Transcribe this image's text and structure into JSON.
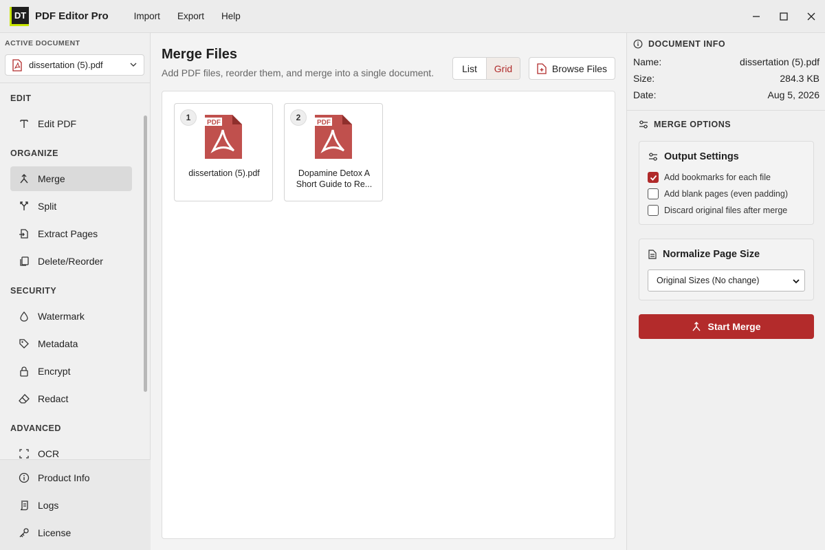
{
  "app": {
    "logo_text": "DT",
    "title": "PDF Editor Pro"
  },
  "menu": {
    "items": [
      "Import",
      "Export",
      "Help"
    ]
  },
  "sidebar": {
    "active_doc_label": "ACTIVE DOCUMENT",
    "active_doc_value": "dissertation (5).pdf",
    "sections": {
      "edit": "EDIT",
      "organize": "ORGANIZE",
      "security": "SECURITY",
      "advanced": "ADVANCED"
    },
    "items": {
      "edit_pdf": "Edit PDF",
      "merge": "Merge",
      "split": "Split",
      "extract_pages": "Extract Pages",
      "delete_reorder": "Delete/Reorder",
      "watermark": "Watermark",
      "metadata": "Metadata",
      "encrypt": "Encrypt",
      "redact": "Redact",
      "ocr": "OCR"
    },
    "bottom": {
      "product_info": "Product Info",
      "logs": "Logs",
      "license": "License"
    }
  },
  "main": {
    "title": "Merge Files",
    "subtitle": "Add PDF files, reorder them, and merge into a single document.",
    "view_list": "List",
    "view_grid": "Grid",
    "browse_label": "Browse Files",
    "thumb_label": "PDF",
    "files": [
      {
        "index": "1",
        "name": "dissertation (5).pdf"
      },
      {
        "index": "2",
        "name": "Dopamine Detox A Short Guide to Re..."
      }
    ]
  },
  "doc_info": {
    "heading": "DOCUMENT INFO",
    "name_label": "Name:",
    "name_value": "dissertation (5).pdf",
    "size_label": "Size:",
    "size_value": "284.3 KB",
    "date_label": "Date:",
    "date_value": "Aug 5, 2026"
  },
  "merge_options": {
    "heading": "MERGE OPTIONS",
    "output_settings_title": "Output Settings",
    "options": [
      {
        "label": "Add bookmarks for each file",
        "checked": true
      },
      {
        "label": "Add blank pages (even padding)",
        "checked": false
      },
      {
        "label": "Discard original files after merge",
        "checked": false
      }
    ],
    "normalize_title": "Normalize Page Size",
    "normalize_value": "Original Sizes (No change)",
    "start_label": "Start Merge"
  },
  "colors": {
    "accent": "#b32b2b",
    "logo_accent": "#c8e600",
    "pdf_red": "#c0504d"
  }
}
